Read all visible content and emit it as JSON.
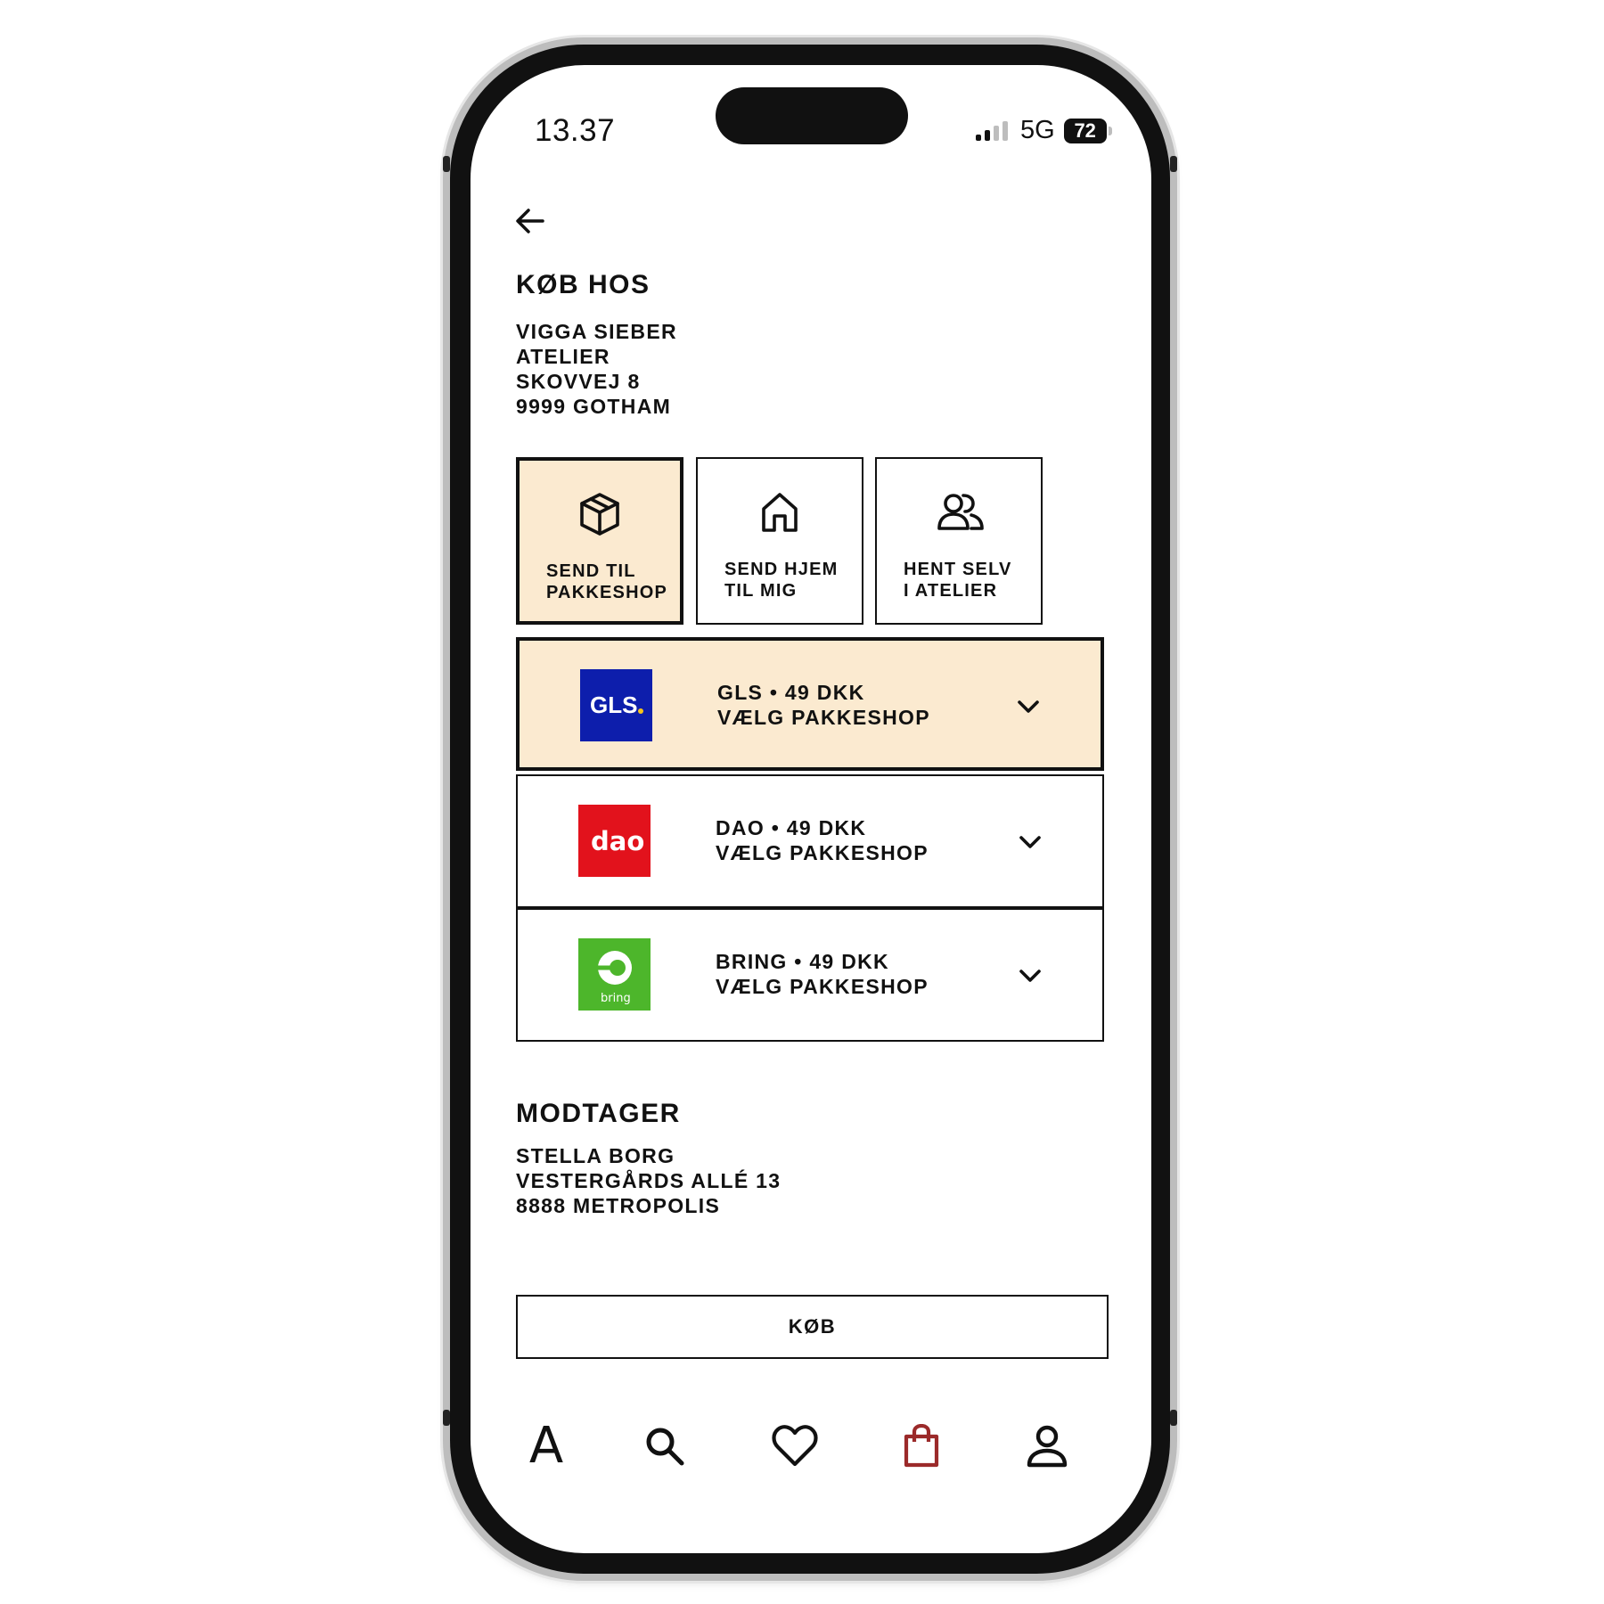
{
  "status_bar": {
    "time": "13.37",
    "network": "5G",
    "battery": "72"
  },
  "header": {
    "title": "KØB HOS"
  },
  "seller": {
    "lines": [
      "VIGGA SIEBER",
      "ATELIER",
      "SKOVVEJ 8",
      "9999 GOTHAM"
    ]
  },
  "delivery_options": [
    {
      "icon": "package-icon",
      "line1": "SEND TIL",
      "line2": "PAKKESHOP",
      "selected": true
    },
    {
      "icon": "house-icon",
      "line1": "SEND HJEM",
      "line2": "TIL MIG",
      "selected": false
    },
    {
      "icon": "people-icon",
      "line1": "HENT SELV",
      "line2": "I ATELIER",
      "selected": false
    }
  ],
  "carriers": [
    {
      "logo_text": "GLS",
      "logo_color": "#0d1eac",
      "line1": "GLS • 49 DKK",
      "line2": "VÆLG PAKKESHOP",
      "selected": true
    },
    {
      "logo_text": "dao",
      "logo_color": "#e2121c",
      "line1": "DAO • 49 DKK",
      "line2": "VÆLG PAKKESHOP",
      "selected": false
    },
    {
      "logo_text": "bring",
      "logo_color": "#4db62b",
      "line1": "BRING • 49 DKK",
      "line2": "VÆLG PAKKESHOP",
      "selected": false
    }
  ],
  "recipient": {
    "title": "MODTAGER",
    "lines": [
      "STELLA BORG",
      "VESTERGÅRDS ALLÉ 13",
      "8888 METROPOLIS"
    ]
  },
  "buy_button": {
    "label": "KØB"
  },
  "bottom_nav": [
    {
      "icon": "home-a-icon",
      "glyph": "A"
    },
    {
      "icon": "search-icon"
    },
    {
      "icon": "heart-icon"
    },
    {
      "icon": "shopping-bag-icon",
      "active": true
    },
    {
      "icon": "profile-icon"
    }
  ],
  "colors": {
    "selected_bg": "#fbead0",
    "accent_active": "#9b2a2a",
    "selection_border": "#111111"
  }
}
